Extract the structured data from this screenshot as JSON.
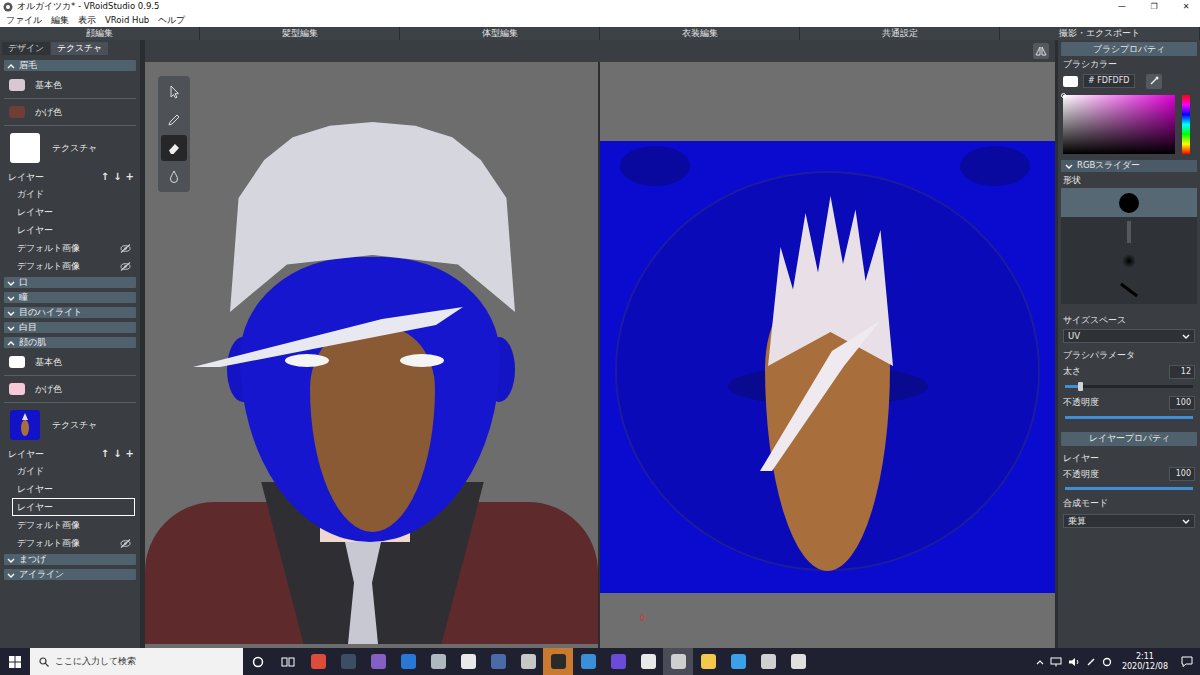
{
  "window": {
    "title": "オルガイツカ* - VRoidStudio 0.9.5",
    "controls": [
      "—",
      "❐",
      "✕"
    ]
  },
  "menu": [
    "ファイル",
    "編集",
    "表示",
    "VRoid Hub",
    "ヘルプ"
  ],
  "mode_tabs": [
    {
      "label": "顔編集",
      "selected": false
    },
    {
      "label": "髪型編集",
      "selected": false
    },
    {
      "label": "体型編集",
      "selected": false
    },
    {
      "label": "衣装編集",
      "selected": false
    },
    {
      "label": "共通設定",
      "selected": false
    },
    {
      "label": "撮影・エクスポート",
      "selected": false
    }
  ],
  "left_panel": {
    "tabs": [
      {
        "label": "デザイン",
        "selected": false
      },
      {
        "label": "テクスチャ",
        "selected": true
      }
    ],
    "sections": [
      {
        "title": "眉毛",
        "expanded": true,
        "colors": [
          {
            "label": "基本色",
            "color": "#d8c7d4"
          },
          {
            "label": "かげ色",
            "color": "#6f3e37"
          }
        ],
        "texture": {
          "label": "テクスチャ",
          "kind": "white"
        },
        "layers_label": "レイヤー",
        "layer_buttons": [
          "↑",
          "↓",
          "+"
        ],
        "layers": [
          {
            "name": "ガイド",
            "hidden": false,
            "selected": false
          },
          {
            "name": "レイヤー",
            "hidden": false,
            "selected": false
          },
          {
            "name": "レイヤー",
            "hidden": false,
            "selected": false
          },
          {
            "name": "デフォルト画像",
            "hidden": true,
            "selected": false
          },
          {
            "name": "デフォルト画像",
            "hidden": true,
            "selected": false
          }
        ]
      },
      {
        "title": "口",
        "expanded": false
      },
      {
        "title": "瞳",
        "expanded": false
      },
      {
        "title": "目のハイライト",
        "expanded": false
      },
      {
        "title": "白目",
        "expanded": false
      },
      {
        "title": "顔の肌",
        "expanded": true,
        "colors": [
          {
            "label": "基本色",
            "color": "#ffffff"
          },
          {
            "label": "かげ色",
            "color": "#f6c8d8"
          }
        ],
        "texture": {
          "label": "テクスチャ",
          "kind": "face"
        },
        "layers_label": "レイヤー",
        "layer_buttons": [
          "↑",
          "↓",
          "+"
        ],
        "layers": [
          {
            "name": "ガイド",
            "hidden": false,
            "selected": false
          },
          {
            "name": "レイヤー",
            "hidden": false,
            "selected": false
          },
          {
            "name": "レイヤー",
            "hidden": false,
            "selected": true
          },
          {
            "name": "デフォルト画像",
            "hidden": false,
            "selected": false
          },
          {
            "name": "デフォルト画像",
            "hidden": true,
            "selected": false
          }
        ]
      },
      {
        "title": "まつげ",
        "expanded": false
      },
      {
        "title": "アイライン",
        "expanded": false
      }
    ]
  },
  "viewport": {
    "tools": [
      {
        "kind": "pointer",
        "selected": false
      },
      {
        "kind": "pen",
        "selected": false
      },
      {
        "kind": "eraser",
        "selected": true
      },
      {
        "kind": "fill",
        "selected": false
      }
    ]
  },
  "texture_view": {
    "marker": "0"
  },
  "brush": {
    "title": "ブラシプロパティ",
    "color_label": "ブラシカラー",
    "color": "#FDFDFD",
    "hex": "# FDFDFD",
    "rgb": {
      "label": "RGBスライダー",
      "expanded": false
    },
    "shape_label": "形状",
    "shapes": [
      {
        "kind": "hard",
        "selected": true
      },
      {
        "kind": "line",
        "selected": false
      },
      {
        "kind": "soft",
        "selected": false
      },
      {
        "kind": "slash",
        "selected": false
      }
    ],
    "size_space": {
      "label": "サイズスペース",
      "value": "UV"
    },
    "params_label": "ブラシパラメータ",
    "params": [
      {
        "label": "太さ",
        "value": "12",
        "level": 0.12
      },
      {
        "label": "不透明度",
        "value": "100",
        "level": 1
      }
    ]
  },
  "layer_props": {
    "title": "レイヤープロパティ",
    "layer_label": "レイヤー",
    "opacity": {
      "label": "不透明度",
      "value": "100",
      "level": 1
    },
    "blend": {
      "label": "合成モード",
      "value": "乗算"
    }
  },
  "taskbar": {
    "search_placeholder": "ここに入力して検索",
    "apps": [
      {
        "color": "#dd4b39",
        "open": false,
        "flashing": false
      },
      {
        "color": "#3c4e63",
        "open": false,
        "flashing": false
      },
      {
        "color": "#865fc5",
        "open": false,
        "flashing": false
      },
      {
        "color": "#2a78d6",
        "open": false,
        "flashing": false
      },
      {
        "color": "#b0b8bf",
        "open": false,
        "flashing": false
      },
      {
        "color": "#e8e8e8",
        "open": false,
        "flashing": false
      },
      {
        "color": "#4a6aa8",
        "open": false,
        "flashing": false
      },
      {
        "color": "#c7c7c7",
        "open": false,
        "flashing": false
      },
      {
        "color": "#2a2a2a",
        "open": false,
        "flashing": true
      },
      {
        "color": "#3b8fd9",
        "open": false,
        "flashing": false
      },
      {
        "color": "#6c4bd8",
        "open": false,
        "flashing": false
      },
      {
        "color": "#e8e8e8",
        "open": false,
        "flashing": false
      },
      {
        "color": "#cfcfcf",
        "open": true,
        "flashing": false
      },
      {
        "color": "#f2c94c",
        "open": false,
        "flashing": false
      },
      {
        "color": "#3aa0e8",
        "open": false,
        "flashing": false
      },
      {
        "color": "#d0d0d0",
        "open": false,
        "flashing": false
      },
      {
        "color": "#e0e0e0",
        "open": false,
        "flashing": false
      }
    ],
    "time": "2:11",
    "date": "2020/12/08"
  }
}
